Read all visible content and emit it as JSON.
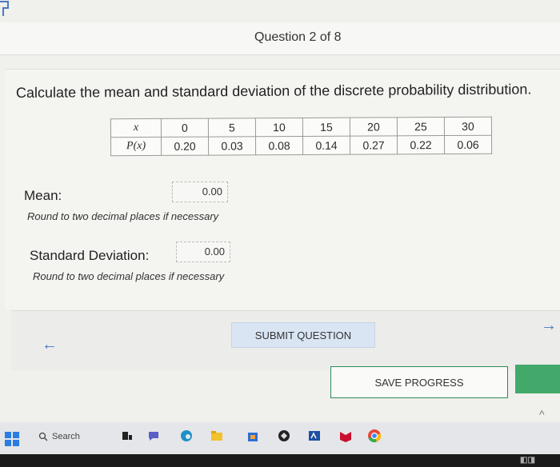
{
  "question": {
    "counter": "Question 2 of 8"
  },
  "problem": {
    "prompt": "Calculate the mean and standard deviation of the discrete probability distribution.",
    "table": {
      "x_label": "x",
      "p_label": "P(x)",
      "x_values": [
        "0",
        "5",
        "10",
        "15",
        "20",
        "25",
        "30"
      ],
      "p_values": [
        "0.20",
        "0.03",
        "0.08",
        "0.14",
        "0.27",
        "0.22",
        "0.06"
      ]
    }
  },
  "mean": {
    "label": "Mean:",
    "value": "0.00",
    "hint": "Round to two decimal places if necessary"
  },
  "sd": {
    "label": "Standard Deviation:",
    "value": "0.00",
    "hint": "Round to two decimal places if necessary"
  },
  "nav": {
    "back_icon": "←",
    "forward_icon": "→",
    "submit_label": "SUBMIT QUESTION",
    "save_label": "SAVE PROGRESS"
  },
  "taskbar": {
    "search_label": "Search"
  },
  "colors": {
    "accent": "#4a78c4",
    "save_border": "#2e8b57",
    "save_green": "#43a96b"
  }
}
